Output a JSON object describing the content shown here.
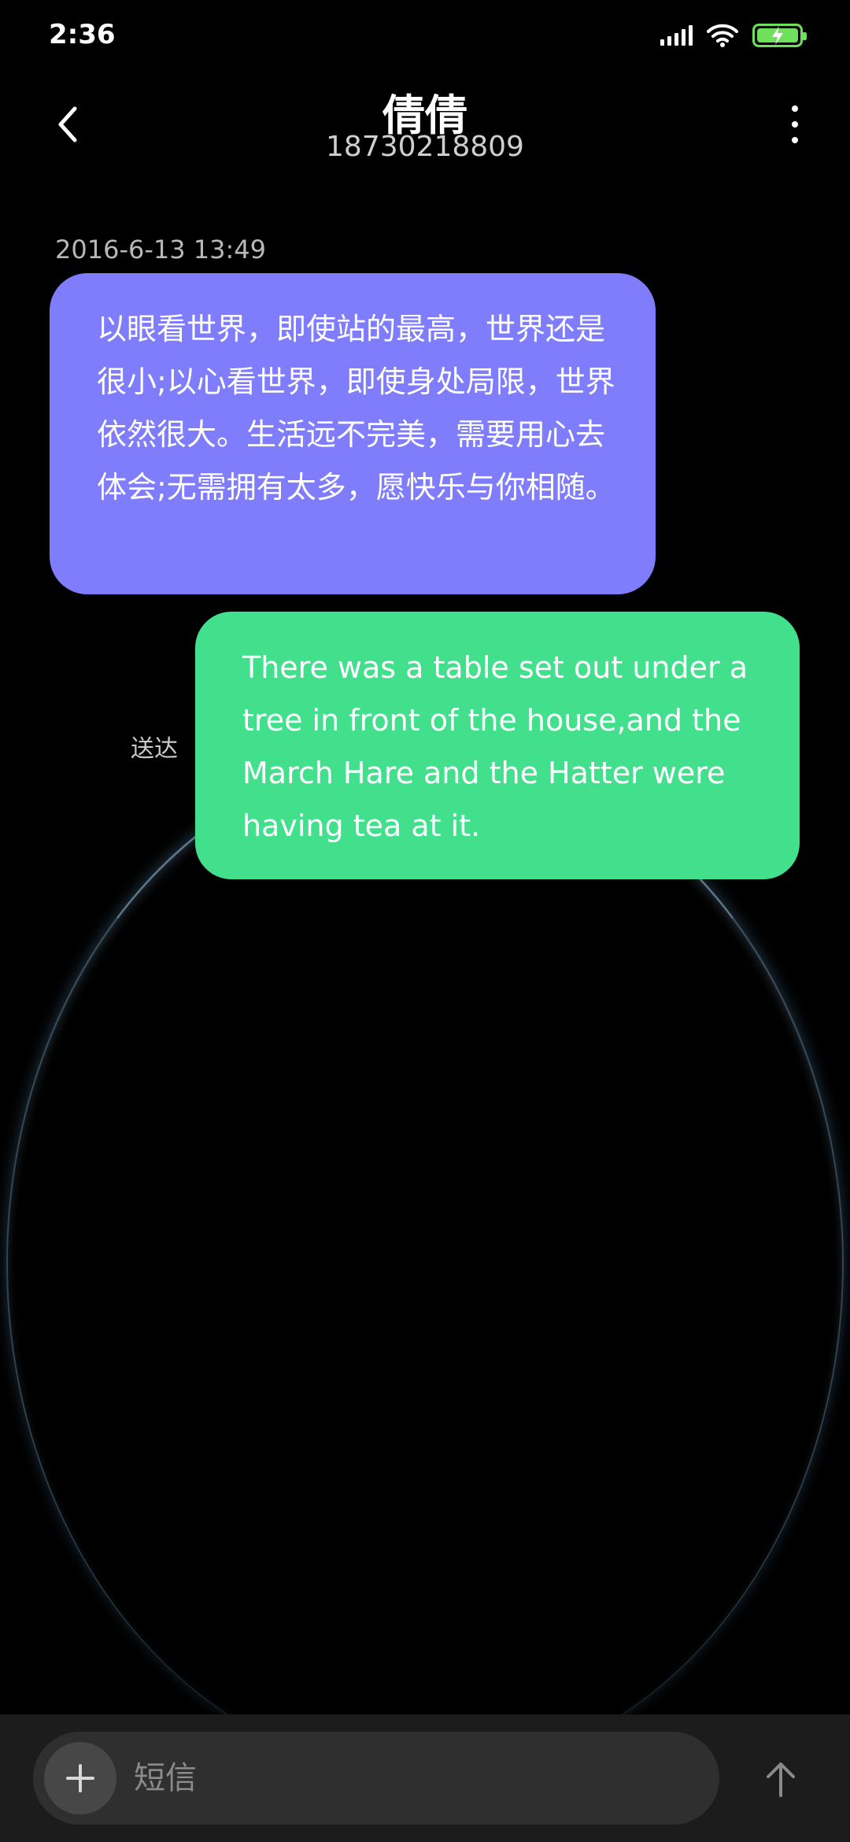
{
  "status_bar": {
    "time": "2:36",
    "battery_color": "#6fe05a"
  },
  "header": {
    "contact_name": "倩倩",
    "contact_number": "18730218809",
    "back_icon": "chevron-left-icon",
    "menu_icon": "more-vertical-icon"
  },
  "conversation": {
    "timestamp": "2016-6-13 13:49",
    "messages": [
      {
        "direction": "incoming",
        "text": "以眼看世界，即使站的最高，世界还是很小;以心看世界，即使身处局限，世界依然很大。生活远不完美，需要用心去体会;无需拥有太多，愿快乐与你相随。",
        "bubble_color": "#7f7dfb"
      },
      {
        "direction": "outgoing",
        "text": "There was a table set out under a tree in front of the house,and the March Hare and the Hatter were having tea at it.",
        "bubble_color": "#42e08d",
        "status": "送达"
      }
    ]
  },
  "composer": {
    "placeholder": "短信",
    "value": "",
    "add_icon": "plus-icon",
    "send_icon": "arrow-up-icon"
  }
}
